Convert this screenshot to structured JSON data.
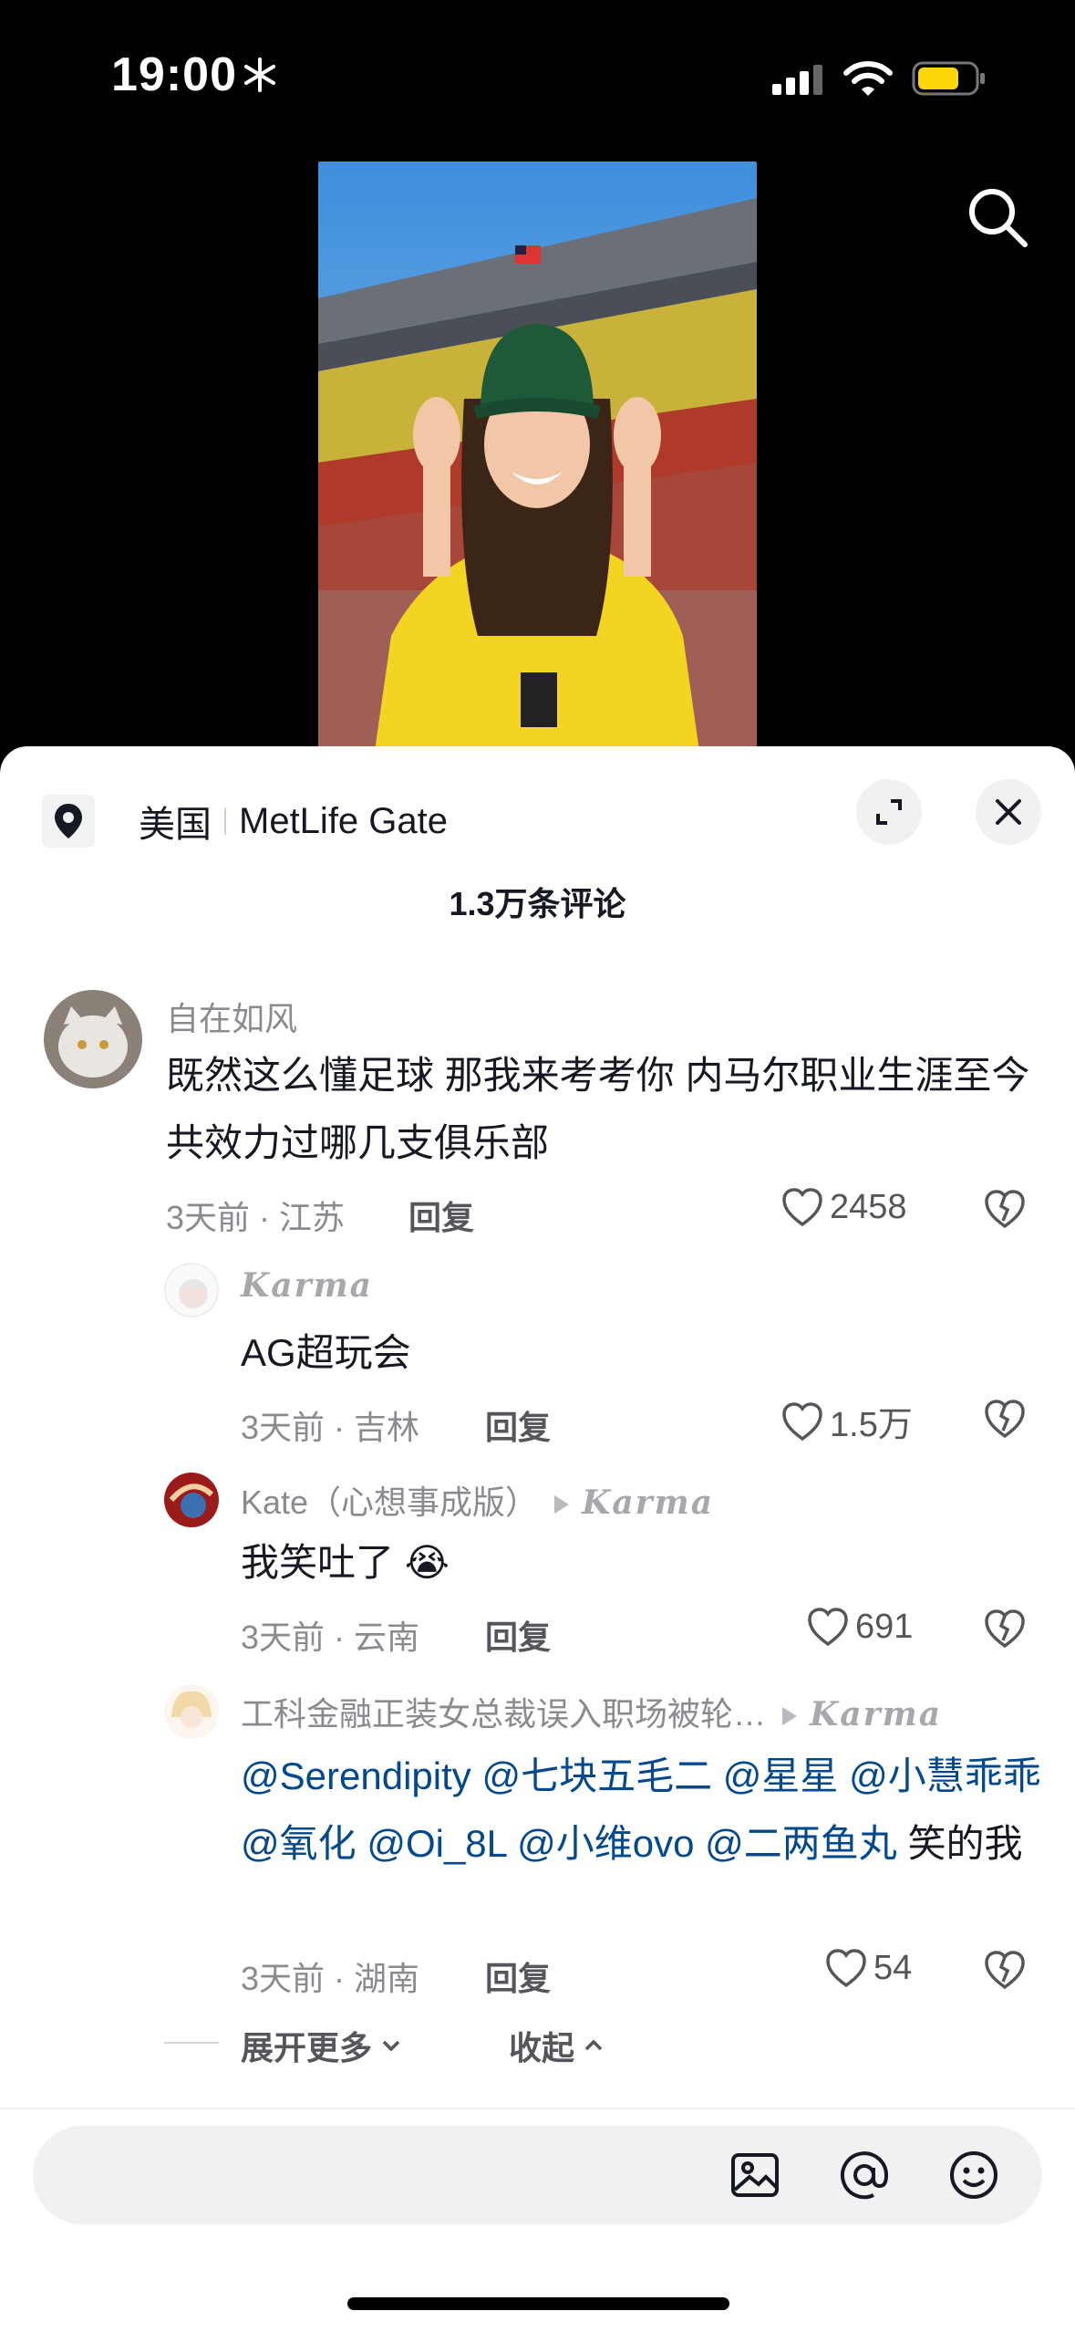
{
  "status_bar": {
    "time": "19:00"
  },
  "location": {
    "country": "美国",
    "place": "MetLife Gate"
  },
  "comment_count": "1.3万条评论",
  "comments": [
    {
      "author": "自在如风",
      "content": "既然这么懂足球 那我来考考你 内马尔职业生涯至今共效力过哪几支俱乐部",
      "time_loc": "3天前 · 江苏",
      "reply": "回复",
      "likes": "2458"
    },
    {
      "author": "Karma",
      "content": "AG超玩会",
      "time_loc": "3天前 · 吉林",
      "reply": "回复",
      "likes": "1.5万"
    },
    {
      "author": "Kate（心想事成版）",
      "reply_to": "Karma",
      "content": "我笑吐了",
      "emoji": "😭",
      "time_loc": "3天前 · 云南",
      "reply": "回复",
      "likes": "691"
    },
    {
      "author": "工科金融正装女总裁误入职场被轮…",
      "reply_to": "Karma",
      "mentions": [
        "@Serendipity",
        "@七块五毛二",
        "@星星",
        "@小慧乖乖",
        "@氧化",
        "@Oi_8L",
        "@小维ovo",
        "@二两鱼丸"
      ],
      "content_tail": "笑的我",
      "time_loc": "3天前 · 湖南",
      "reply": "回复",
      "likes": "54"
    }
  ],
  "actions": {
    "expand_more": "展开更多",
    "collapse": "收起"
  },
  "input": {
    "placeholder": ""
  },
  "colors": {
    "mention": "#04498d",
    "muted": "#8a8b91",
    "text": "#161823"
  }
}
